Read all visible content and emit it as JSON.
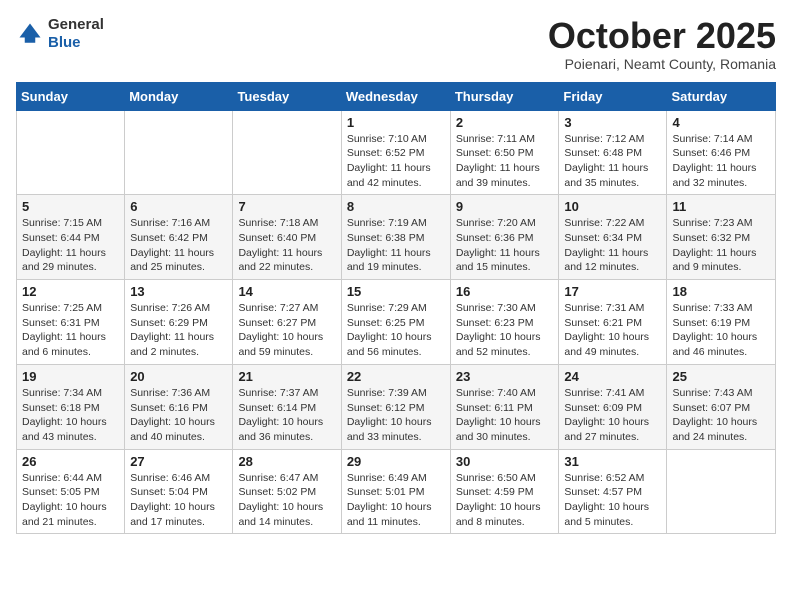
{
  "header": {
    "logo_line1": "General",
    "logo_line2": "Blue",
    "month": "October 2025",
    "location": "Poienari, Neamt County, Romania"
  },
  "days_of_week": [
    "Sunday",
    "Monday",
    "Tuesday",
    "Wednesday",
    "Thursday",
    "Friday",
    "Saturday"
  ],
  "weeks": [
    [
      {
        "day": "",
        "info": ""
      },
      {
        "day": "",
        "info": ""
      },
      {
        "day": "",
        "info": ""
      },
      {
        "day": "1",
        "info": "Sunrise: 7:10 AM\nSunset: 6:52 PM\nDaylight: 11 hours and 42 minutes."
      },
      {
        "day": "2",
        "info": "Sunrise: 7:11 AM\nSunset: 6:50 PM\nDaylight: 11 hours and 39 minutes."
      },
      {
        "day": "3",
        "info": "Sunrise: 7:12 AM\nSunset: 6:48 PM\nDaylight: 11 hours and 35 minutes."
      },
      {
        "day": "4",
        "info": "Sunrise: 7:14 AM\nSunset: 6:46 PM\nDaylight: 11 hours and 32 minutes."
      }
    ],
    [
      {
        "day": "5",
        "info": "Sunrise: 7:15 AM\nSunset: 6:44 PM\nDaylight: 11 hours and 29 minutes."
      },
      {
        "day": "6",
        "info": "Sunrise: 7:16 AM\nSunset: 6:42 PM\nDaylight: 11 hours and 25 minutes."
      },
      {
        "day": "7",
        "info": "Sunrise: 7:18 AM\nSunset: 6:40 PM\nDaylight: 11 hours and 22 minutes."
      },
      {
        "day": "8",
        "info": "Sunrise: 7:19 AM\nSunset: 6:38 PM\nDaylight: 11 hours and 19 minutes."
      },
      {
        "day": "9",
        "info": "Sunrise: 7:20 AM\nSunset: 6:36 PM\nDaylight: 11 hours and 15 minutes."
      },
      {
        "day": "10",
        "info": "Sunrise: 7:22 AM\nSunset: 6:34 PM\nDaylight: 11 hours and 12 minutes."
      },
      {
        "day": "11",
        "info": "Sunrise: 7:23 AM\nSunset: 6:32 PM\nDaylight: 11 hours and 9 minutes."
      }
    ],
    [
      {
        "day": "12",
        "info": "Sunrise: 7:25 AM\nSunset: 6:31 PM\nDaylight: 11 hours and 6 minutes."
      },
      {
        "day": "13",
        "info": "Sunrise: 7:26 AM\nSunset: 6:29 PM\nDaylight: 11 hours and 2 minutes."
      },
      {
        "day": "14",
        "info": "Sunrise: 7:27 AM\nSunset: 6:27 PM\nDaylight: 10 hours and 59 minutes."
      },
      {
        "day": "15",
        "info": "Sunrise: 7:29 AM\nSunset: 6:25 PM\nDaylight: 10 hours and 56 minutes."
      },
      {
        "day": "16",
        "info": "Sunrise: 7:30 AM\nSunset: 6:23 PM\nDaylight: 10 hours and 52 minutes."
      },
      {
        "day": "17",
        "info": "Sunrise: 7:31 AM\nSunset: 6:21 PM\nDaylight: 10 hours and 49 minutes."
      },
      {
        "day": "18",
        "info": "Sunrise: 7:33 AM\nSunset: 6:19 PM\nDaylight: 10 hours and 46 minutes."
      }
    ],
    [
      {
        "day": "19",
        "info": "Sunrise: 7:34 AM\nSunset: 6:18 PM\nDaylight: 10 hours and 43 minutes."
      },
      {
        "day": "20",
        "info": "Sunrise: 7:36 AM\nSunset: 6:16 PM\nDaylight: 10 hours and 40 minutes."
      },
      {
        "day": "21",
        "info": "Sunrise: 7:37 AM\nSunset: 6:14 PM\nDaylight: 10 hours and 36 minutes."
      },
      {
        "day": "22",
        "info": "Sunrise: 7:39 AM\nSunset: 6:12 PM\nDaylight: 10 hours and 33 minutes."
      },
      {
        "day": "23",
        "info": "Sunrise: 7:40 AM\nSunset: 6:11 PM\nDaylight: 10 hours and 30 minutes."
      },
      {
        "day": "24",
        "info": "Sunrise: 7:41 AM\nSunset: 6:09 PM\nDaylight: 10 hours and 27 minutes."
      },
      {
        "day": "25",
        "info": "Sunrise: 7:43 AM\nSunset: 6:07 PM\nDaylight: 10 hours and 24 minutes."
      }
    ],
    [
      {
        "day": "26",
        "info": "Sunrise: 6:44 AM\nSunset: 5:05 PM\nDaylight: 10 hours and 21 minutes."
      },
      {
        "day": "27",
        "info": "Sunrise: 6:46 AM\nSunset: 5:04 PM\nDaylight: 10 hours and 17 minutes."
      },
      {
        "day": "28",
        "info": "Sunrise: 6:47 AM\nSunset: 5:02 PM\nDaylight: 10 hours and 14 minutes."
      },
      {
        "day": "29",
        "info": "Sunrise: 6:49 AM\nSunset: 5:01 PM\nDaylight: 10 hours and 11 minutes."
      },
      {
        "day": "30",
        "info": "Sunrise: 6:50 AM\nSunset: 4:59 PM\nDaylight: 10 hours and 8 minutes."
      },
      {
        "day": "31",
        "info": "Sunrise: 6:52 AM\nSunset: 4:57 PM\nDaylight: 10 hours and 5 minutes."
      },
      {
        "day": "",
        "info": ""
      }
    ]
  ]
}
